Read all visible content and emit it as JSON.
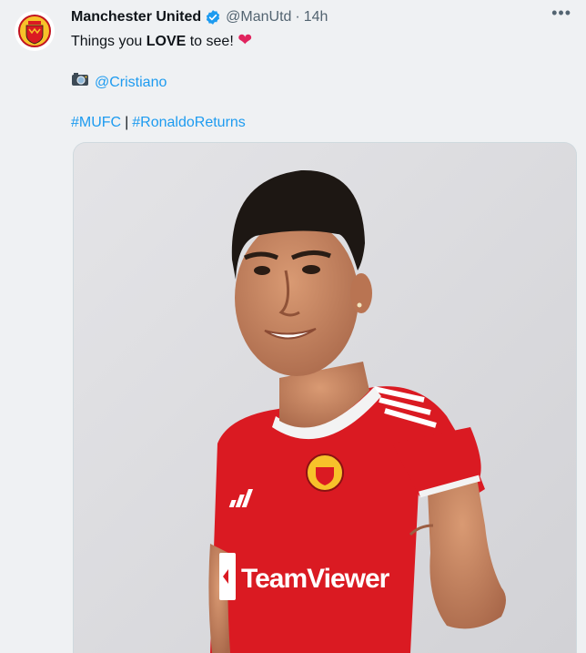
{
  "tweet": {
    "display_name": "Manchester United",
    "handle": "@ManUtd",
    "separator": "·",
    "time": "14h",
    "more_label": "•••",
    "text_prefix": "Things you ",
    "text_bold": "LOVE",
    "text_suffix": " to see! ",
    "heart_glyph": "❤",
    "camera_glyph": "📸",
    "mention": "@Cristiano",
    "hashtag1": "#MUFC",
    "hashtag_separator": "|",
    "hashtag2": "#RonaldoReturns",
    "media": {
      "alt": "Cristiano Ronaldo in Manchester United home kit pointing",
      "shirt_sponsor": "TeamViewer"
    },
    "icons": [
      "club-crest-icon",
      "verified-badge-icon",
      "more-options-icon",
      "heart-icon",
      "camera-icon"
    ],
    "colors": {
      "link": "#1d9bf0",
      "verified": "#1d9bf0",
      "heart": "#e0245e",
      "kit_red": "#da1a22"
    }
  }
}
